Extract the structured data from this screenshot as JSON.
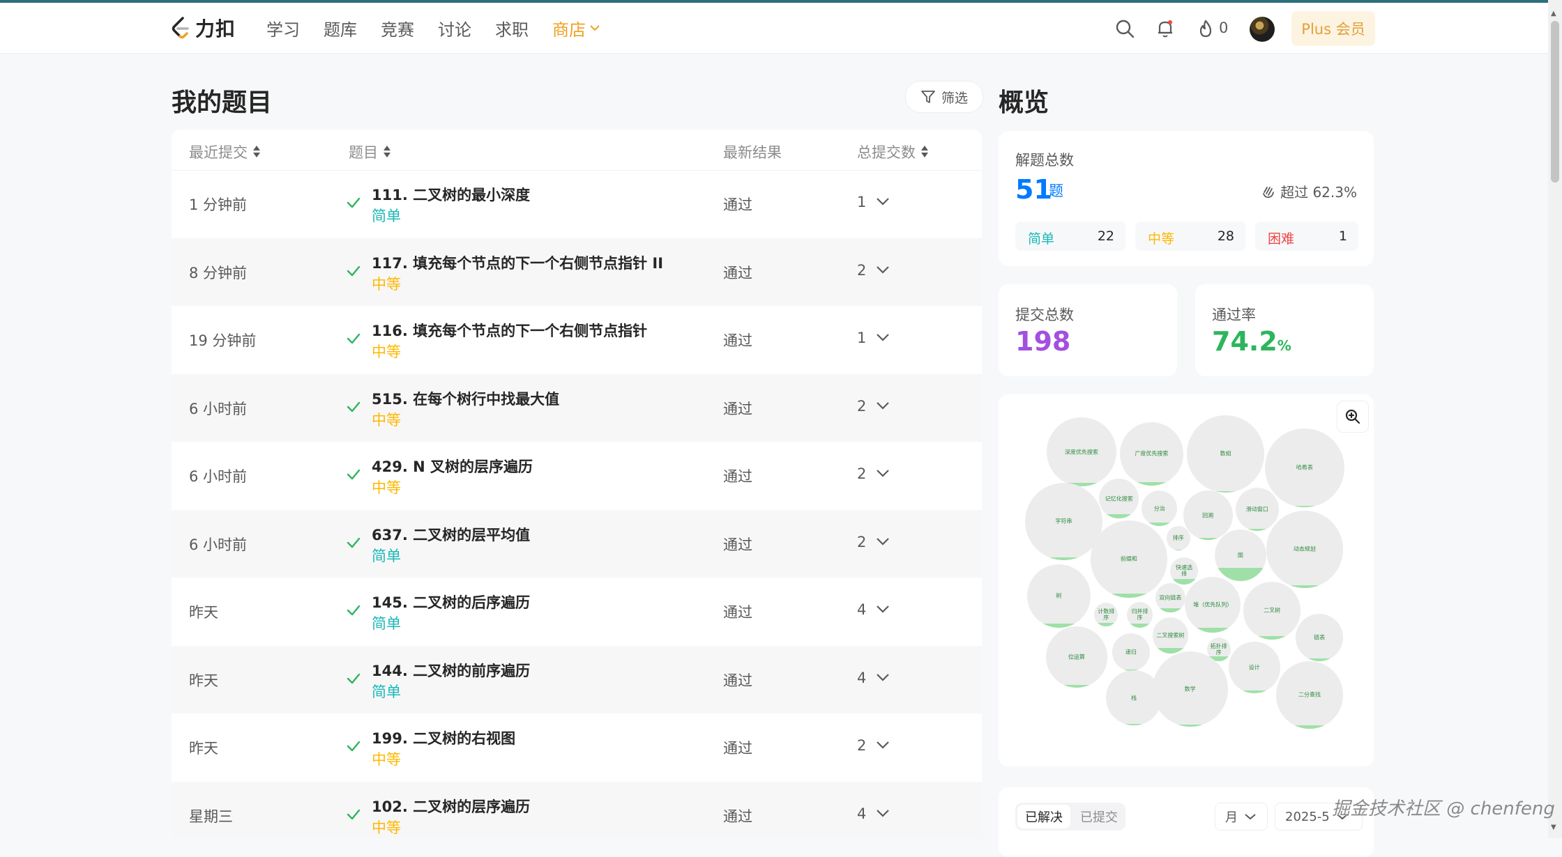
{
  "brand": {
    "logo_text": "力扣"
  },
  "nav": {
    "items": [
      "学习",
      "题库",
      "竞赛",
      "讨论",
      "求职"
    ],
    "shop_label": "商店"
  },
  "header": {
    "flame_count": "0",
    "plus_label": "Plus 会员"
  },
  "list": {
    "title": "我的题目",
    "filter_label": "筛选",
    "columns": {
      "recent": "最近提交",
      "problem": "题目",
      "result": "最新结果",
      "count": "总提交数"
    },
    "rows": [
      {
        "time": "1 分钟前",
        "title": "111. 二叉树的最小深度",
        "difficulty": "简单",
        "level": "easy",
        "result": "通过",
        "count": "1"
      },
      {
        "time": "8 分钟前",
        "title": "117. 填充每个节点的下一个右侧节点指针 II",
        "difficulty": "中等",
        "level": "medium",
        "result": "通过",
        "count": "2"
      },
      {
        "time": "19 分钟前",
        "title": "116. 填充每个节点的下一个右侧节点指针",
        "difficulty": "中等",
        "level": "medium",
        "result": "通过",
        "count": "1"
      },
      {
        "time": "6 小时前",
        "title": "515. 在每个树行中找最大值",
        "difficulty": "中等",
        "level": "medium",
        "result": "通过",
        "count": "2"
      },
      {
        "time": "6 小时前",
        "title": "429. N 叉树的层序遍历",
        "difficulty": "中等",
        "level": "medium",
        "result": "通过",
        "count": "2"
      },
      {
        "time": "6 小时前",
        "title": "637. 二叉树的层平均值",
        "difficulty": "简单",
        "level": "easy",
        "result": "通过",
        "count": "2"
      },
      {
        "time": "昨天",
        "title": "145. 二叉树的后序遍历",
        "difficulty": "简单",
        "level": "easy",
        "result": "通过",
        "count": "4"
      },
      {
        "time": "昨天",
        "title": "144. 二叉树的前序遍历",
        "difficulty": "简单",
        "level": "easy",
        "result": "通过",
        "count": "4"
      },
      {
        "time": "昨天",
        "title": "199. 二叉树的右视图",
        "difficulty": "中等",
        "level": "medium",
        "result": "通过",
        "count": "2"
      },
      {
        "time": "星期三",
        "title": "102. 二叉树的层序遍历",
        "difficulty": "中等",
        "level": "medium",
        "result": "通过",
        "count": "4"
      }
    ]
  },
  "overview": {
    "title": "概览",
    "solved_label": "解题总数",
    "solved_count": "51",
    "solved_unit": "题",
    "beat_text": "超过 62.3%",
    "difficulty": [
      {
        "label": "简单",
        "count": "22",
        "color": "#1cb8b8"
      },
      {
        "label": "中等",
        "count": "28",
        "color": "#ffb800"
      },
      {
        "label": "困难",
        "count": "1",
        "color": "#ef4743"
      }
    ],
    "submissions_label": "提交总数",
    "submissions_count": "198",
    "pass_rate_label": "通过率",
    "pass_rate_value": "74.2",
    "pass_rate_unit": "%"
  },
  "topics": [
    {
      "label": "深度优先搜索",
      "fill": 0.05
    },
    {
      "label": "广度优先搜索",
      "fill": 0.05
    },
    {
      "label": "数组",
      "fill": 0.02
    },
    {
      "label": "哈希表",
      "fill": 0.02
    },
    {
      "label": "字符串",
      "fill": 0.03
    },
    {
      "label": "记忆化搜索",
      "fill": 0.1
    },
    {
      "label": "分治",
      "fill": 0.1
    },
    {
      "label": "回溯",
      "fill": 0.05
    },
    {
      "label": "滑动窗口",
      "fill": 0.05
    },
    {
      "label": "动态规划",
      "fill": 0.03
    },
    {
      "label": "前缀和",
      "fill": 0.05
    },
    {
      "label": "排序",
      "fill": 0.03
    },
    {
      "label": "图",
      "fill": 0.25
    },
    {
      "label": "快速选择",
      "fill": 0.2
    },
    {
      "label": "树",
      "fill": 0.06
    },
    {
      "label": "计数排序",
      "fill": 0.15
    },
    {
      "label": "归并排序",
      "fill": 0.15
    },
    {
      "label": "双向链表",
      "fill": 0.15
    },
    {
      "label": "堆（优先队列）",
      "fill": 0.08
    },
    {
      "label": "二叉树",
      "fill": 0.06
    },
    {
      "label": "链表",
      "fill": 0.06
    },
    {
      "label": "二叉搜索树",
      "fill": 0.15
    },
    {
      "label": "拓扑排序",
      "fill": 0.2
    },
    {
      "label": "设计",
      "fill": 0.05
    },
    {
      "label": "位运算",
      "fill": 0.05
    },
    {
      "label": "递归",
      "fill": 0.05
    },
    {
      "label": "栈",
      "fill": 0.03
    },
    {
      "label": "数学",
      "fill": 0.03
    },
    {
      "label": "二分查找",
      "fill": 0.05
    }
  ],
  "calendar": {
    "tab_solved": "已解决",
    "tab_submitted": "已提交",
    "period": "月",
    "month": "2025-5"
  },
  "watermark": "掘金技术社区 @ chenfeng"
}
